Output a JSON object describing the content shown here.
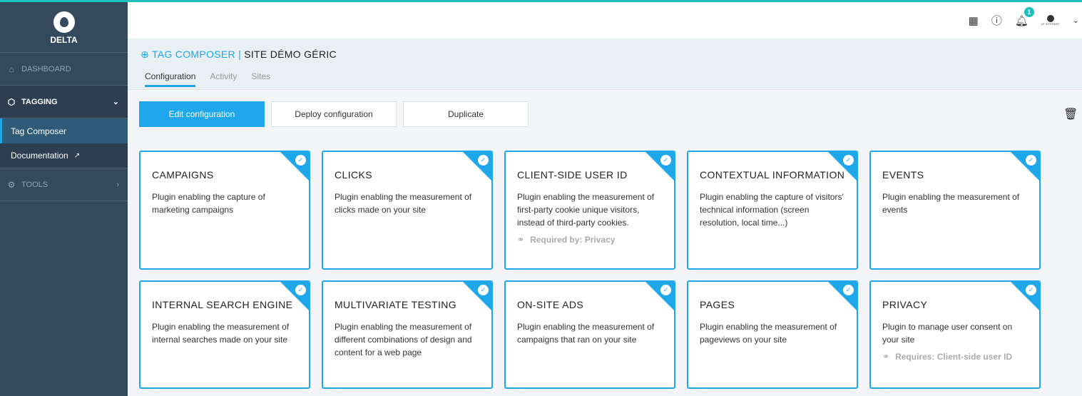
{
  "brand": {
    "name": "DELTA"
  },
  "sidebar": {
    "items": [
      {
        "label": "DASHBOARD",
        "icon": "home-icon"
      },
      {
        "label": "TAGGING",
        "icon": "tag-icon",
        "children": [
          {
            "label": "Tag Composer"
          },
          {
            "label": "Documentation"
          }
        ]
      },
      {
        "label": "TOOLS",
        "icon": "gear-icon"
      }
    ]
  },
  "header": {
    "notifications": "1",
    "account_label": "AT INTERNET"
  },
  "page": {
    "section": "TAG COMPOSER",
    "separator": "|",
    "site": "SITE DÉMO GÉRIC",
    "tabs": [
      {
        "label": "Configuration"
      },
      {
        "label": "Activity"
      },
      {
        "label": "Sites"
      }
    ]
  },
  "actions": {
    "edit": "Edit configuration",
    "deploy": "Deploy configuration",
    "duplicate": "Duplicate"
  },
  "accent": "#1ea7ea",
  "plugins": [
    {
      "title": "CAMPAIGNS",
      "desc": "Plugin enabling the capture of marketing campaigns",
      "dep": ""
    },
    {
      "title": "CLICKS",
      "desc": "Plugin enabling the measurement of clicks made on your site",
      "dep": ""
    },
    {
      "title": "CLIENT-SIDE USER ID",
      "desc": "Plugin enabling the measurement of first-party cookie unique visitors, instead of third-party cookies.",
      "dep": "Required by: Privacy"
    },
    {
      "title": "CONTEXTUAL INFORMATION",
      "desc": "Plugin enabling the capture of visitors' technical information (screen resolution, local time...)",
      "dep": ""
    },
    {
      "title": "EVENTS",
      "desc": "Plugin enabling the measurement of events",
      "dep": ""
    },
    {
      "title": "INTERNAL SEARCH ENGINE",
      "desc": "Plugin enabling the measurement of internal searches made on your site",
      "dep": ""
    },
    {
      "title": "MULTIVARIATE TESTING",
      "desc": "Plugin enabling the measurement of different combinations of design and content for a web page",
      "dep": ""
    },
    {
      "title": "ON-SITE ADS",
      "desc": "Plugin enabling the measurement of campaigns that ran on your site",
      "dep": ""
    },
    {
      "title": "PAGES",
      "desc": "Plugin enabling the measurement of pageviews on your site",
      "dep": ""
    },
    {
      "title": "PRIVACY",
      "desc": "Plugin to manage user consent on your site",
      "dep": "Requires: Client-side user ID"
    }
  ]
}
